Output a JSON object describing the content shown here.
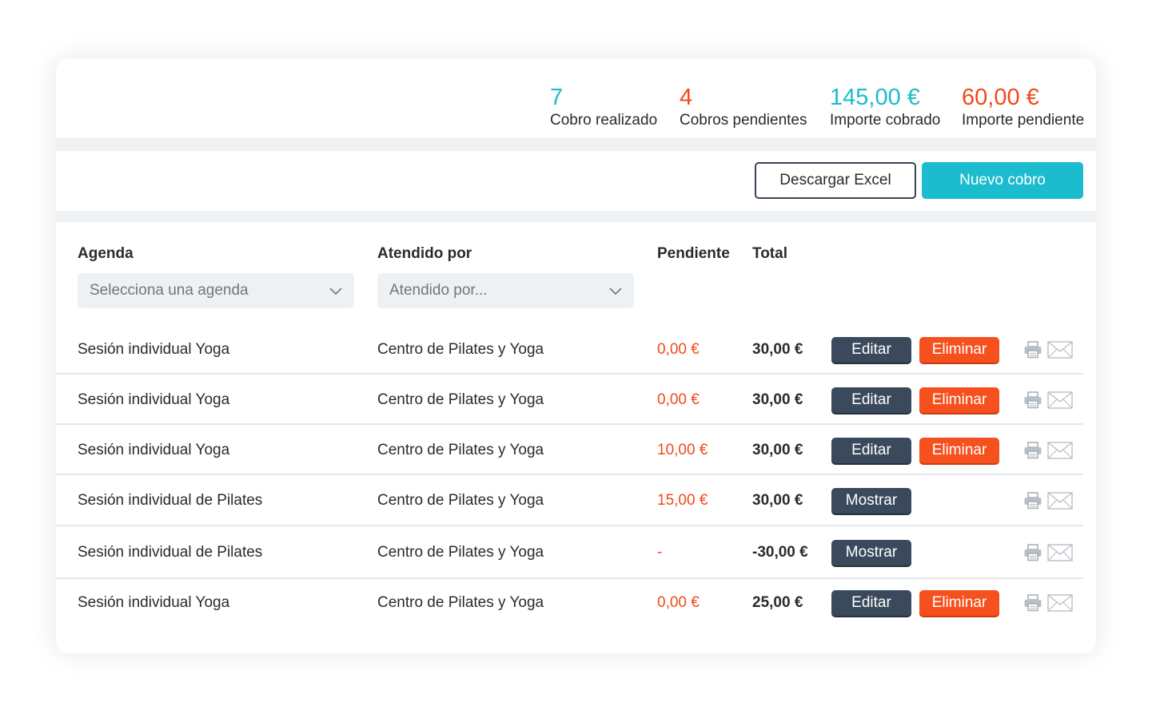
{
  "stats": [
    {
      "value": "7",
      "label": "Cobro realizado",
      "color": "#1bbccd"
    },
    {
      "value": "4",
      "label": "Cobros pendientes",
      "color": "#f04a1a"
    },
    {
      "value": "145,00 €",
      "label": "Importe cobrado",
      "color": "#1bbccd"
    },
    {
      "value": "60,00 €",
      "label": "Importe pendiente",
      "color": "#f04a1a"
    }
  ],
  "actions": {
    "download_label": "Descargar Excel",
    "new_label": "Nuevo cobro"
  },
  "table": {
    "headers": {
      "agenda": "Agenda",
      "attended": "Atendido por",
      "pending": "Pendiente",
      "total": "Total"
    },
    "filters": {
      "agenda_placeholder": "Selecciona una agenda",
      "attended_placeholder": "Atendido por..."
    },
    "buttons": {
      "edit": "Editar",
      "delete": "Eliminar",
      "show": "Mostrar"
    },
    "rows": [
      {
        "agenda": "Sesión individual Yoga",
        "attended": "Centro de Pilates y Yoga",
        "pending": "0,00 €",
        "total": "30,00 €",
        "mode": "edit"
      },
      {
        "agenda": "Sesión individual Yoga",
        "attended": "Centro de Pilates y Yoga",
        "pending": "0,00 €",
        "total": "30,00 €",
        "mode": "edit"
      },
      {
        "agenda": "Sesión individual Yoga",
        "attended": "Centro de Pilates y Yoga",
        "pending": "10,00 €",
        "total": "30,00 €",
        "mode": "edit"
      },
      {
        "agenda": "Sesión individual de Pilates",
        "attended": "Centro de Pilates y Yoga",
        "pending": "15,00 €",
        "total": "30,00 €",
        "mode": "show"
      },
      {
        "agenda": "Sesión individual de Pilates",
        "attended": "Centro de Pilates y Yoga",
        "pending": "-",
        "total": "-30,00 €",
        "mode": "show"
      },
      {
        "agenda": "Sesión individual Yoga",
        "attended": "Centro de Pilates y Yoga",
        "pending": "0,00 €",
        "total": "25,00 €",
        "mode": "edit"
      }
    ]
  },
  "icons": {
    "print": "printer-icon",
    "mail": "envelope-icon",
    "dropdown": "chevron-down-icon"
  }
}
